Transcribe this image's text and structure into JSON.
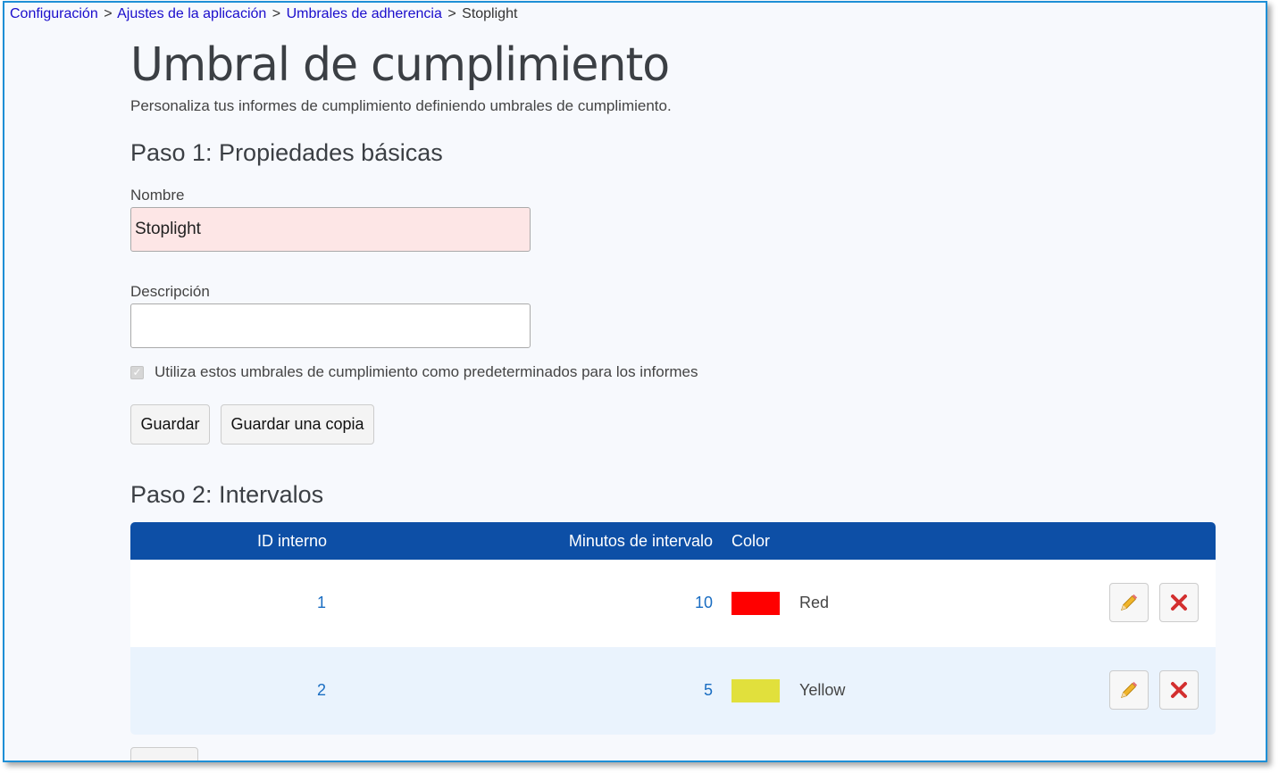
{
  "breadcrumb": {
    "items": [
      "Configuración",
      "Ajustes de la aplicación",
      "Umbrales de adherencia"
    ],
    "current": "Stoplight",
    "separator": ">"
  },
  "page": {
    "title": "Umbral de cumplimiento",
    "subtitle": "Personaliza tus informes de cumplimiento definiendo umbrales de cumplimiento."
  },
  "step1": {
    "title": "Paso 1: Propiedades básicas",
    "name_label": "Nombre",
    "name_value": "Stoplight",
    "description_label": "Descripción",
    "description_value": "",
    "default_checkbox_label": "Utiliza estos umbrales de cumplimiento como predeterminados para los informes",
    "default_checked": true,
    "save_label": "Guardar",
    "save_copy_label": "Guardar una copia"
  },
  "step2": {
    "title": "Paso 2: Intervalos",
    "columns": [
      "ID interno",
      "Minutos de intervalo",
      "Color"
    ],
    "rows": [
      {
        "id": "1",
        "minutes": "10",
        "color_name": "Red",
        "color_hex": "#ff0000"
      },
      {
        "id": "2",
        "minutes": "5",
        "color_name": "Yellow",
        "color_hex": "#e1e03c"
      }
    ]
  },
  "colors": {
    "accent": "#0d4fa6",
    "link": "#1a0dcc",
    "frame_border": "#1e8fd6"
  }
}
